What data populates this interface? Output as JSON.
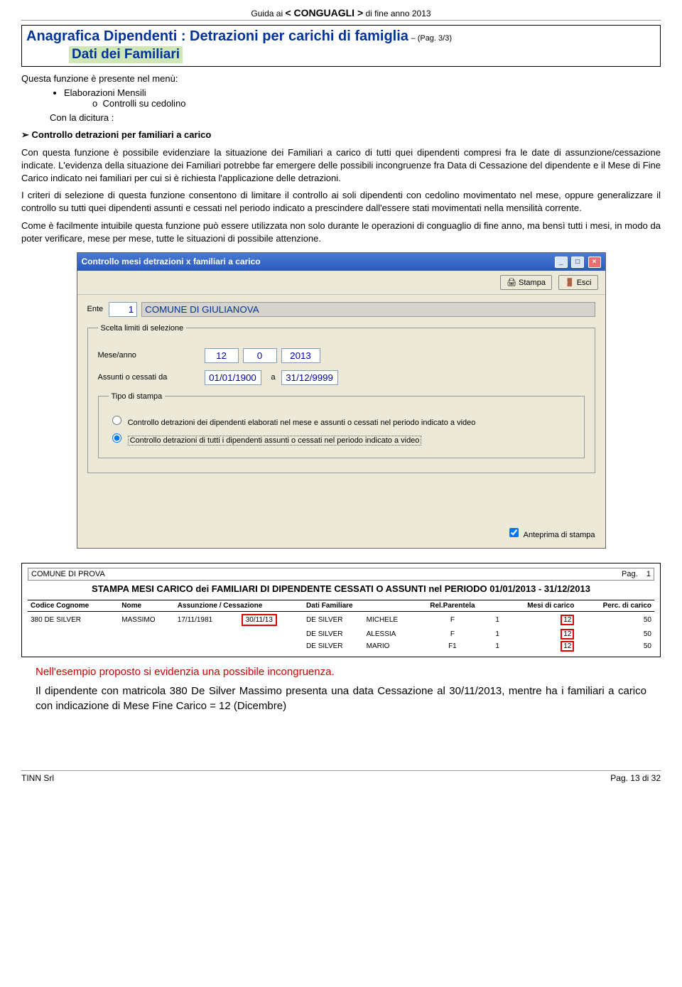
{
  "header": {
    "pre": "Guida   ai  ",
    "mid": "< CONGUAGLI >",
    "post": "  di fine anno 2013"
  },
  "title": {
    "main": "Anagrafica Dipendenti : Detrazioni per carichi di famiglia",
    "pag": " – (Pag. 3/3)",
    "sub": "Dati dei Familiari"
  },
  "text": {
    "menu_intro": "Questa funzione è presente nel menù:",
    "bul1": "Elaborazioni Mensili",
    "bul2": "Controlli su cedolino",
    "dicitura": "Con la dicitura :",
    "arrow": "Controllo detrazioni per familiari a carico",
    "p1": "Con questa funzione è possibile evidenziare la situazione dei Familiari a carico di tutti quei dipendenti compresi fra le date di assunzione/cessazione indicate. L'evidenza della situazione dei Familiari potrebbe far emergere delle possibili incongruenze fra Data di Cessazione del dipendente e il  Mese di Fine Carico indicato nei familiari per cui si è richiesta l'applicazione delle detrazioni.",
    "p2": "I criteri di selezione di questa funzione consentono di limitare il controllo ai soli dipendenti con cedolino movimentato nel mese,  oppure generalizzare il controllo su tutti quei dipendenti assunti e cessati nel periodo indicato a prescindere dall'essere stati movimentati nella mensilità corrente.",
    "p3": "Come è facilmente intuibile questa funzione può essere utilizzata non solo durante le operazioni di conguaglio di fine anno, ma bensì tutti i mesi,  in modo da poter verificare, mese per mese, tutte le situazioni di possibile attenzione.",
    "red": "Nell'esempio proposto si evidenzia una possibile incongruenza.",
    "p4": "Il dipendente con matricola 380 De Silver Massimo presenta una data Cessazione al 30/11/2013, mentre ha i familiari a carico con indicazione di Mese Fine Carico = 12 (Dicembre)"
  },
  "dialog": {
    "title": "Controllo mesi detrazioni x familiari a carico",
    "stampa": "Stampa",
    "esci": "Esci",
    "ente_label": "Ente",
    "ente_code": "1",
    "ente_name": "COMUNE DI GIULIANOVA",
    "scelta_label": "Scelta limiti di selezione",
    "mese_label": "Mese/anno",
    "mese": "12",
    "progr": "0",
    "anno": "2013",
    "ass_label": "Assunti o cessati da",
    "data_da": "01/01/1900",
    "a_label": "a",
    "data_a": "31/12/9999",
    "tipo_label": "Tipo di stampa",
    "opt1": "Controllo detrazioni dei dipendenti elaborati nel mese e assunti o cessati nel periodo indicato a video",
    "opt2": "Controllo detrazioni di tutti i dipendenti assunti o cessati nel periodo indicato a video",
    "anteprima": "Anteprima di stampa"
  },
  "report": {
    "head_left": "COMUNE DI PROVA",
    "head_right_label": "Pag.",
    "head_right_num": "1",
    "title": "STAMPA MESI CARICO dei FAMILIARI DI DIPENDENTE CESSATI O ASSUNTI nel PERIODO 01/01/2013 - 31/12/2013",
    "cols": {
      "c1": "Codice  Cognome",
      "c2": "Nome",
      "c3": "Assunzione / Cessazione",
      "c4": "Dati Familiare",
      "c5": "Rel.Parentela",
      "c6": "Mesi di carico",
      "c7": "Perc. di carico"
    },
    "rows": [
      {
        "code": "380",
        "cog": "DE SILVER",
        "nome": "MASSIMO",
        "ass": "17/11/1981",
        "cess": "30/11/13",
        "fam_cog": "DE SILVER",
        "fam_nom": "MICHELE",
        "rel": "F",
        "idx": "1",
        "mesi": "12",
        "perc": "50"
      },
      {
        "code": "",
        "cog": "",
        "nome": "",
        "ass": "",
        "cess": "",
        "fam_cog": "DE SILVER",
        "fam_nom": "ALESSIA",
        "rel": "F",
        "idx": "1",
        "mesi": "12",
        "perc": "50"
      },
      {
        "code": "",
        "cog": "",
        "nome": "",
        "ass": "",
        "cess": "",
        "fam_cog": "DE SILVER",
        "fam_nom": "MARIO",
        "rel": "F1",
        "idx": "1",
        "mesi": "12",
        "perc": "50"
      }
    ]
  },
  "footer": {
    "left": "TINN Srl",
    "right": "Pag. 13 di 32"
  }
}
